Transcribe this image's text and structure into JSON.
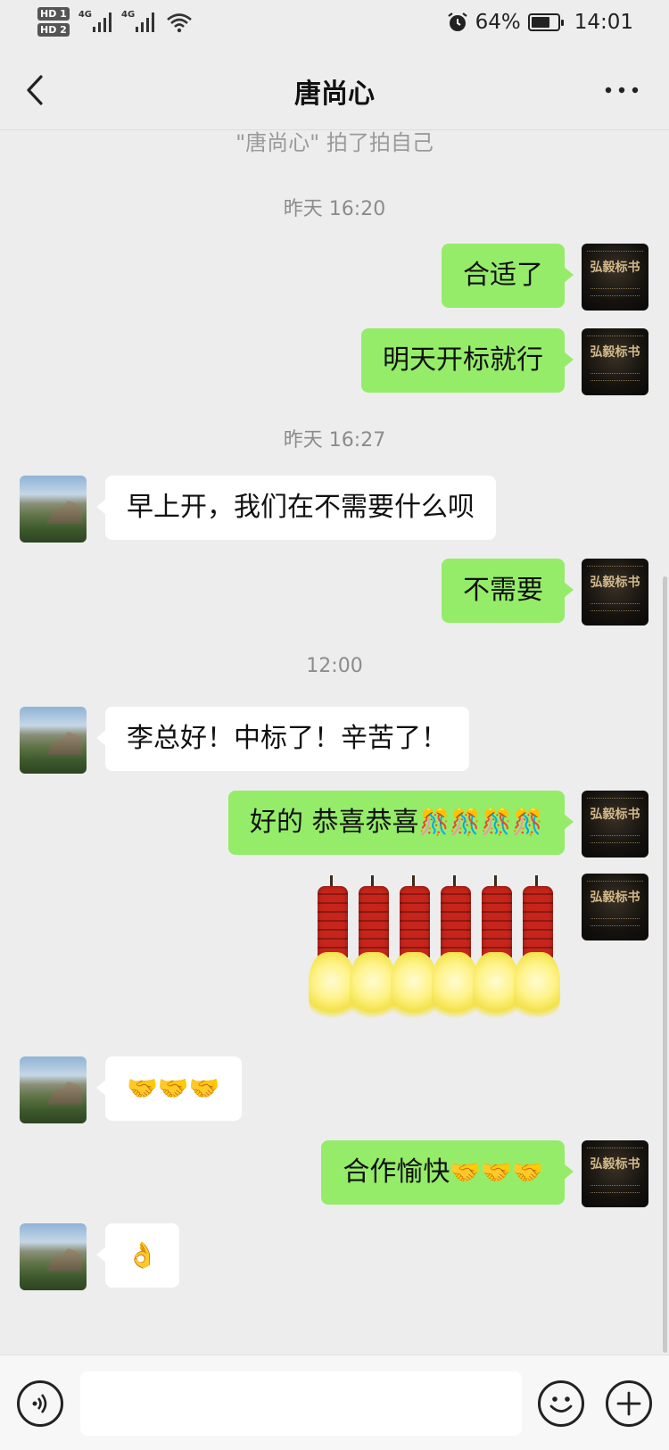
{
  "status_bar": {
    "hd1": "HD 1",
    "hd2": "HD 2",
    "net1": "4G",
    "net2": "4G",
    "battery_text": "64%",
    "battery_level": 0.64,
    "time": "14:01"
  },
  "header": {
    "title": "唐尚心",
    "back_icon": "chevron-left-icon",
    "more_icon": "more-dots-icon"
  },
  "chat": {
    "pat_notice": "\"唐尚心\" 拍了拍自己",
    "timestamps": [
      "昨天 16:20",
      "昨天 16:27",
      "12:00"
    ],
    "my_avatar_logo": "弘毅标书",
    "messages": [
      {
        "side": "out",
        "text": "合适了"
      },
      {
        "side": "out",
        "text": "明天开标就行"
      },
      {
        "side": "in",
        "text": "早上开，我们在不需要什么呗"
      },
      {
        "side": "out",
        "text": "不需要"
      },
      {
        "side": "in",
        "text": "李总好！中标了！辛苦了！"
      },
      {
        "side": "out",
        "text": "好的 恭喜恭喜",
        "emoji": "🎊🎊🎊🎊"
      },
      {
        "side": "out",
        "sticker": "firecrackers-sticker"
      },
      {
        "side": "in",
        "emoji": "🤝🤝🤝"
      },
      {
        "side": "out",
        "text": "合作愉快",
        "emoji": "🤝🤝🤝"
      },
      {
        "side": "in",
        "emoji": "👌"
      }
    ]
  },
  "input_bar": {
    "voice_icon": "voice-icon",
    "input_value": "",
    "emoji_icon": "emoji-face-icon",
    "plus_icon": "plus-icon"
  }
}
